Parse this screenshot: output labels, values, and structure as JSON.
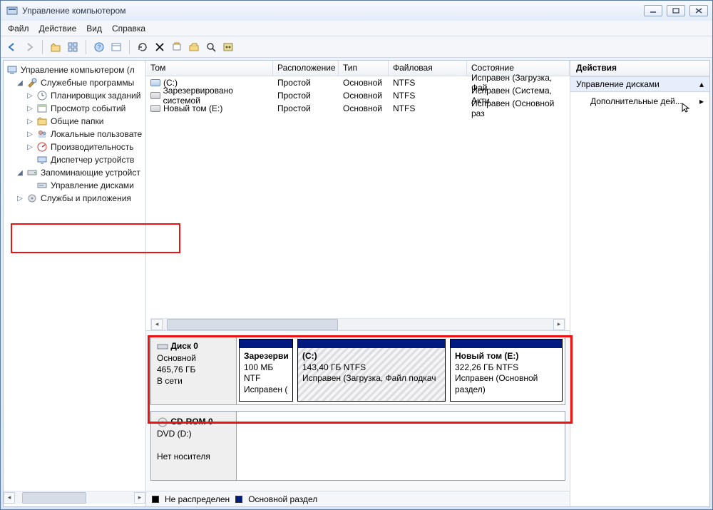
{
  "window": {
    "title": "Управление компьютером"
  },
  "menus": {
    "file": "Файл",
    "action": "Действие",
    "view": "Вид",
    "help": "Справка"
  },
  "tree": {
    "root": "Управление компьютером (л",
    "system_tools": "Служебные программы",
    "task_scheduler": "Планировщик заданий",
    "event_viewer": "Просмотр событий",
    "shared_folders": "Общие папки",
    "local_users": "Локальные пользовате",
    "performance": "Производительность",
    "device_manager": "Диспетчер устройств",
    "storage": "Запоминающие устройст",
    "disk_mgmt": "Управление дисками",
    "services_apps": "Службы и приложения"
  },
  "vol_headers": {
    "volume": "Том",
    "layout": "Расположение",
    "type": "Тип",
    "fs": "Файловая система",
    "status": "Состояние"
  },
  "volumes": [
    {
      "icon": "blue",
      "name": "(C:)",
      "layout": "Простой",
      "type": "Основной",
      "fs": "NTFS",
      "status": "Исправен (Загрузка, Фай"
    },
    {
      "icon": "gray",
      "name": "Зарезервировано системой",
      "layout": "Простой",
      "type": "Основной",
      "fs": "NTFS",
      "status": "Исправен (Система, Акти"
    },
    {
      "icon": "gray",
      "name": "Новый том (E:)",
      "layout": "Простой",
      "type": "Основной",
      "fs": "NTFS",
      "status": "Исправен (Основной раз"
    }
  ],
  "disk0": {
    "title": "Диск 0",
    "kind": "Основной",
    "size": "465,76 ГБ",
    "state": "В сети",
    "p1": {
      "name": "Зарезерви",
      "size": "100 МБ NTF",
      "status": "Исправен ("
    },
    "p2": {
      "name": "(C:)",
      "size": "143,40 ГБ NTFS",
      "status": "Исправен (Загрузка, Файл подкач"
    },
    "p3": {
      "name": "Новый том  (E:)",
      "size": "322,26 ГБ NTFS",
      "status": "Исправен (Основной раздел)"
    }
  },
  "cdrom": {
    "title": "CD-ROM 0",
    "kind": "DVD (D:)",
    "state": "Нет носителя"
  },
  "legend": {
    "unalloc": "Не распределен",
    "primary": "Основной раздел"
  },
  "actions": {
    "header": "Действия",
    "disk_mgmt": "Управление дисками",
    "more": "Дополнительные дей..."
  }
}
